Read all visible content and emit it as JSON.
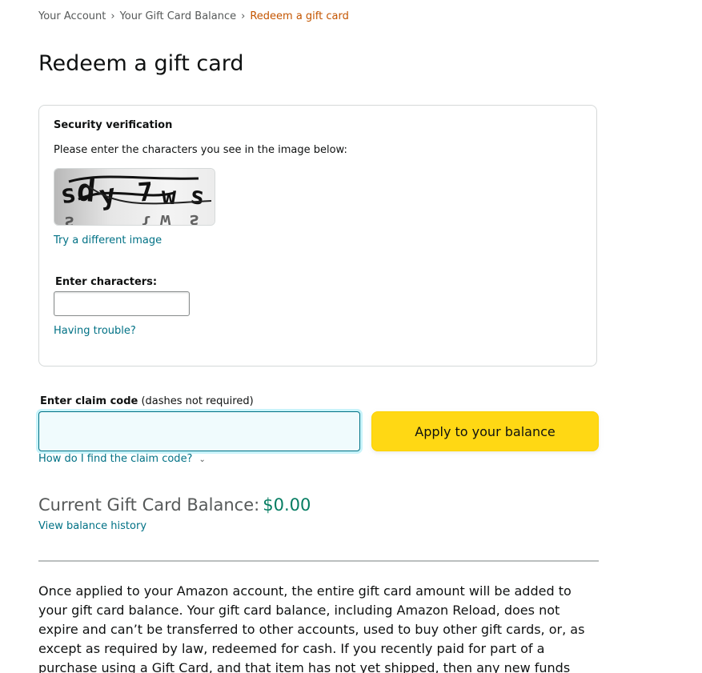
{
  "breadcrumb": {
    "items": [
      "Your Account",
      "Your Gift Card Balance"
    ],
    "separator": "›",
    "current": "Redeem a gift card"
  },
  "page": {
    "title": "Redeem a gift card"
  },
  "security": {
    "title": "Security verification",
    "description": "Please enter the characters you see in the image below:",
    "captcha_text": "sdy7ws",
    "try_different": "Try a different image",
    "enter_label": "Enter characters:",
    "input_value": "",
    "trouble": "Having trouble?"
  },
  "claim": {
    "label": "Enter claim code",
    "label_hint": "(dashes not required)",
    "input_value": "",
    "apply_button": "Apply to your balance",
    "howto_link": "How do I find the claim code?",
    "chevron_icon": "chevron-down-icon"
  },
  "balance": {
    "label": "Current Gift Card Balance:",
    "amount": "$0.00",
    "history_link": "View balance history"
  },
  "info": {
    "text": "Once applied to your Amazon account, the entire gift card amount will be added to your gift card balance. Your gift card balance, including Amazon Reload, does not expire and can’t be transferred to other accounts, used to buy other gift cards, or, as except as required by law, redeemed for cash. If you recently paid for part of a purchase using a Gift Card, and that item has not yet shipped, then any new funds"
  },
  "colors": {
    "link": "#007185",
    "breadcrumb_current": "#c45500",
    "apply_button_bg": "#ffd814",
    "balance_amount": "#067d62",
    "claim_input_bg": "#f0fbfd"
  }
}
